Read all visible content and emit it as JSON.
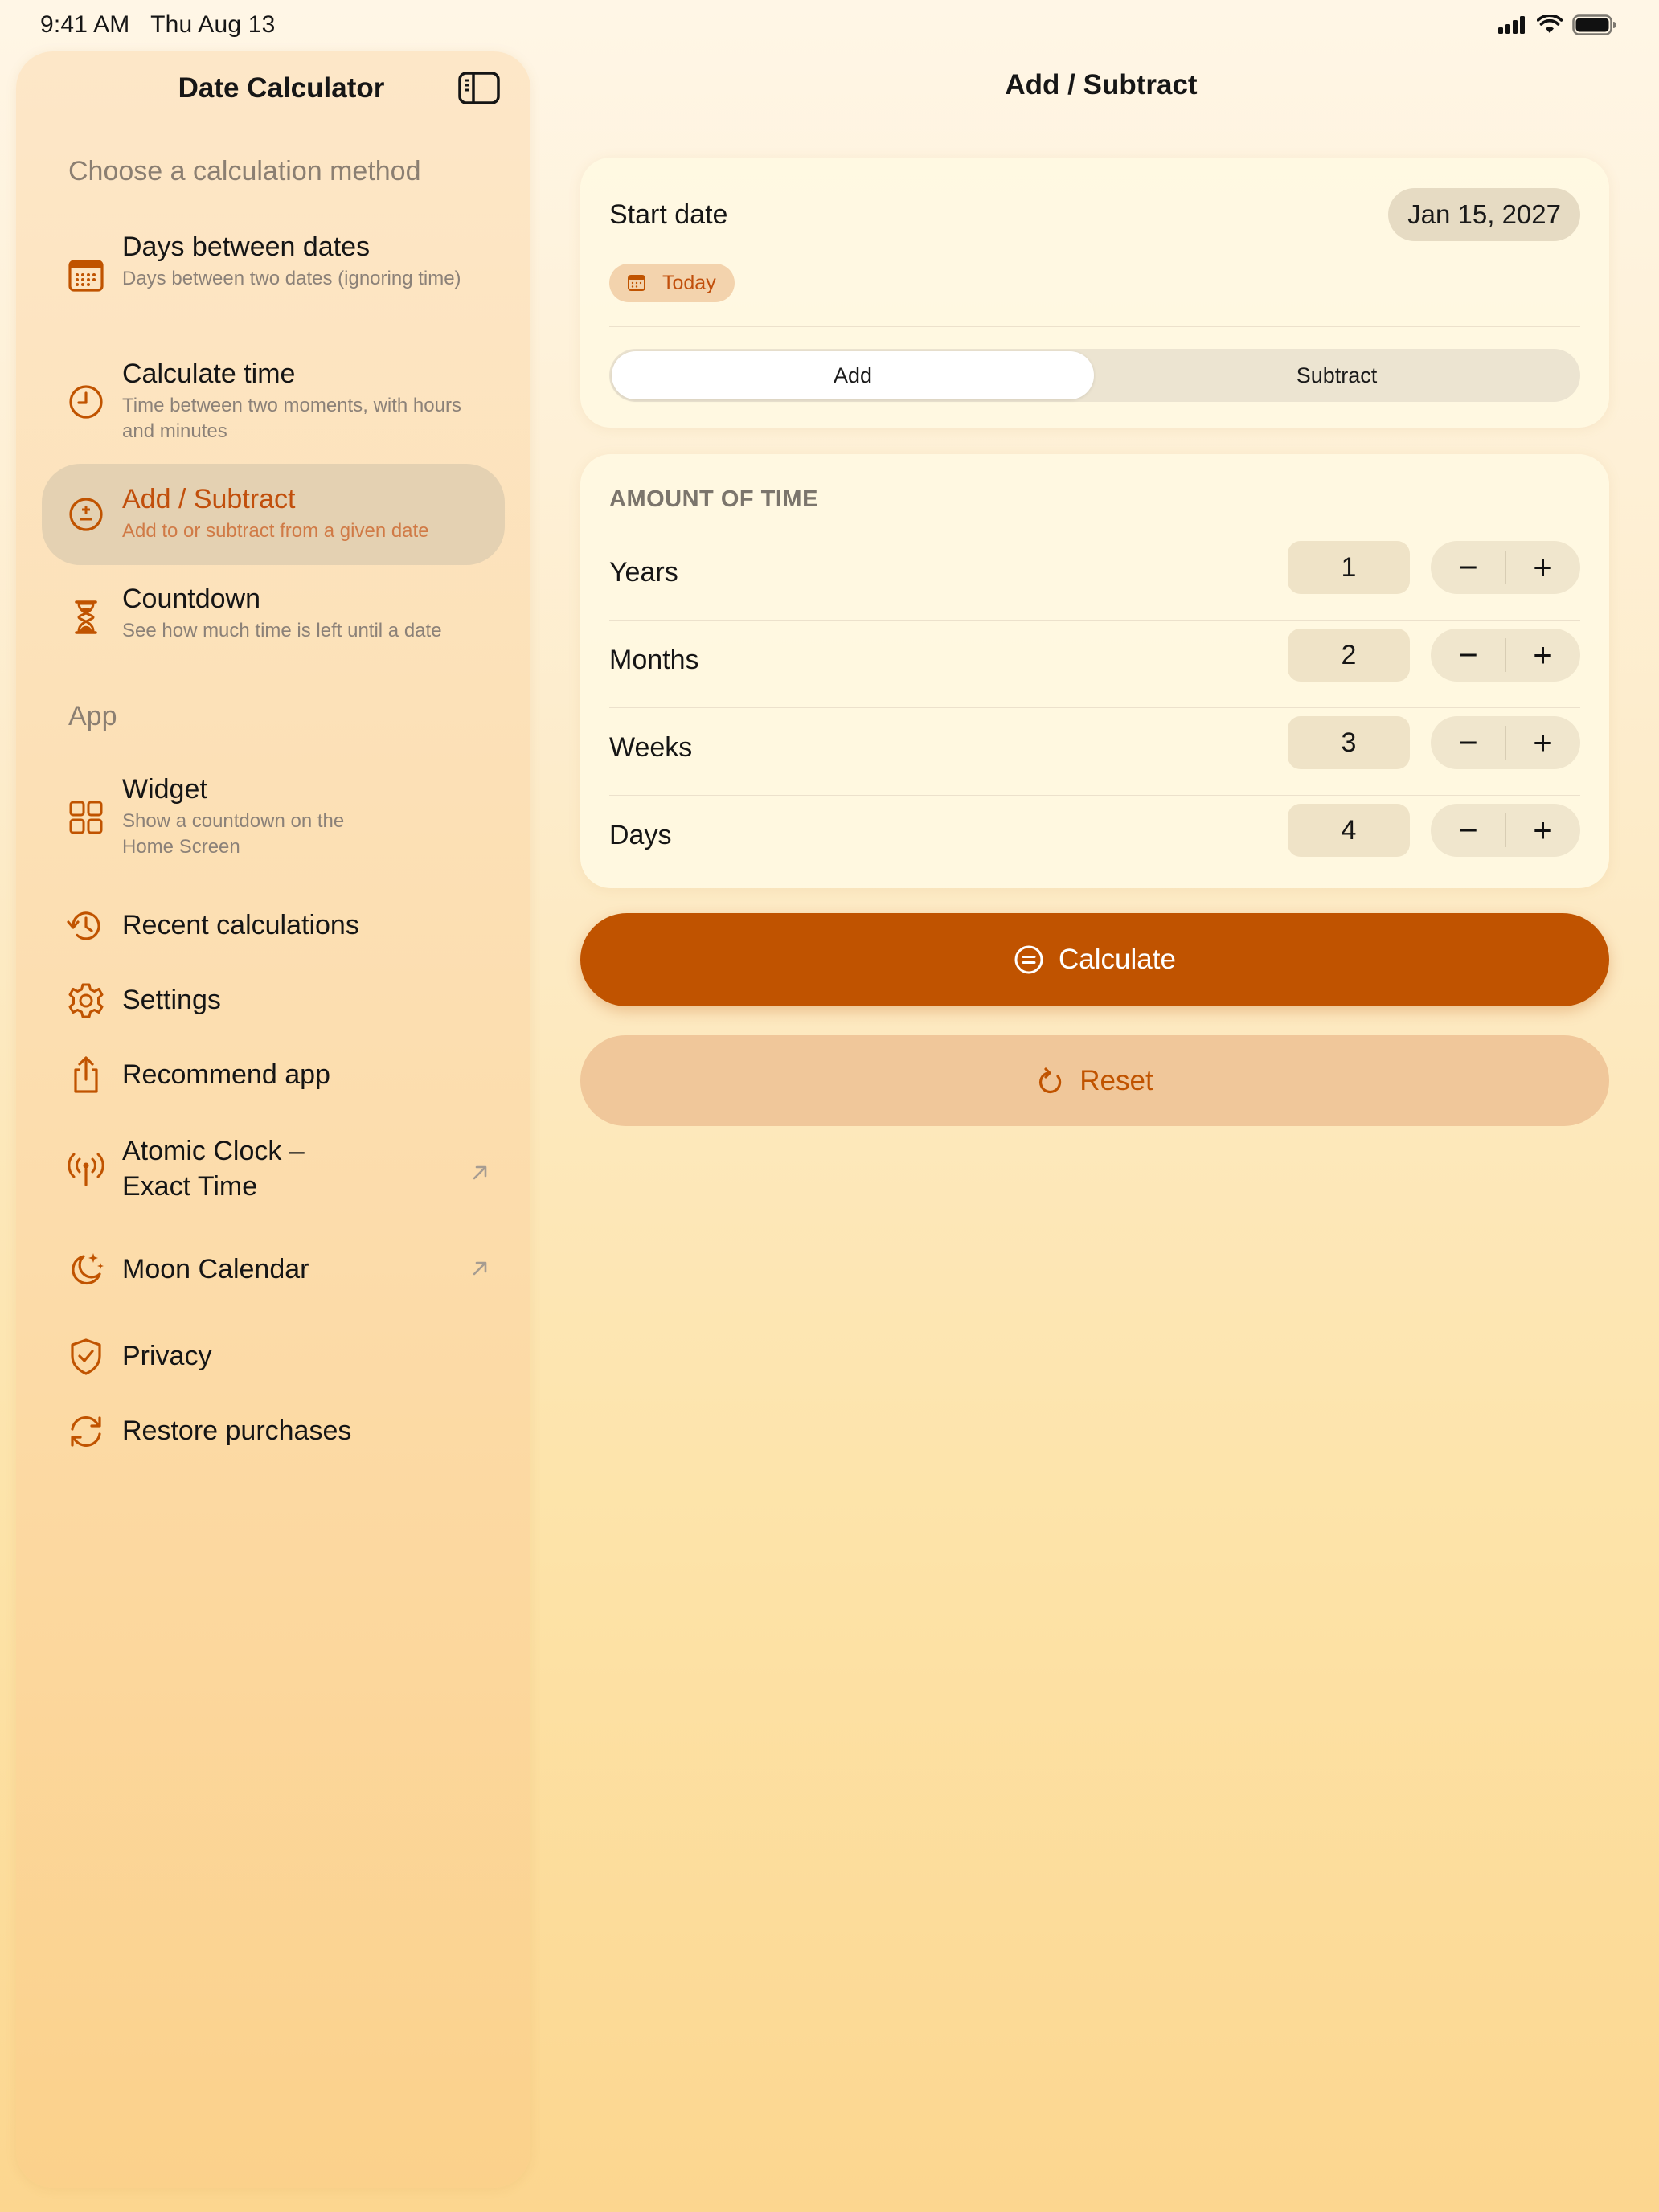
{
  "status": {
    "time": "9:41 AM",
    "date": "Thu Aug 13"
  },
  "sidebar": {
    "title": "Date Calculator",
    "section_methods": "Choose a calculation method",
    "methods": [
      {
        "title": "Days between dates",
        "subtitle": "Days between two dates (ignoring time)",
        "icon": "calendar-grid-icon"
      },
      {
        "title": "Calculate time",
        "subtitle": "Time between two moments, with hours and minutes",
        "icon": "clock-icon"
      },
      {
        "title": "Add / Subtract",
        "subtitle": "Add to or subtract from a given date",
        "icon": "plus-minus-circle-icon",
        "selected": true
      },
      {
        "title": "Countdown",
        "subtitle": "See how much time is left until a date",
        "icon": "hourglass-icon"
      }
    ],
    "section_app": "App",
    "app_items": [
      {
        "title": "Widget",
        "subtitle": "Show a countdown on the Home Screen",
        "icon": "widget-grid-icon"
      },
      {
        "title": "Recent calculations",
        "icon": "history-icon"
      },
      {
        "title": "Settings",
        "icon": "gear-icon"
      },
      {
        "title": "Recommend app",
        "icon": "share-icon"
      },
      {
        "title": "Atomic Clock –\nExact Time",
        "title_line1": "Atomic Clock –",
        "title_line2": "Exact Time",
        "icon": "antenna-icon",
        "external": true
      },
      {
        "title": "Moon Calendar",
        "icon": "moon-stars-icon",
        "external": true
      },
      {
        "title": "Privacy",
        "icon": "shield-check-icon"
      },
      {
        "title": "Restore purchases",
        "icon": "restore-arrows-icon"
      }
    ]
  },
  "main": {
    "title": "Add / Subtract",
    "start_date_label": "Start date",
    "start_date_value": "Jan 15, 2027",
    "today_label": "Today",
    "segments": [
      "Add",
      "Subtract"
    ],
    "selected_segment": "Add",
    "amount_header": "AMOUNT OF TIME",
    "rows": [
      {
        "label": "Years",
        "value": "1"
      },
      {
        "label": "Months",
        "value": "2"
      },
      {
        "label": "Weeks",
        "value": "3"
      },
      {
        "label": "Days",
        "value": "4"
      }
    ],
    "minus_symbol": "−",
    "plus_symbol": "+",
    "calculate_label": "Calculate",
    "reset_label": "Reset"
  },
  "colors": {
    "accent": "#c05300",
    "accent_light": "#f0c79a",
    "selected_bg": "#e4d1b2"
  }
}
